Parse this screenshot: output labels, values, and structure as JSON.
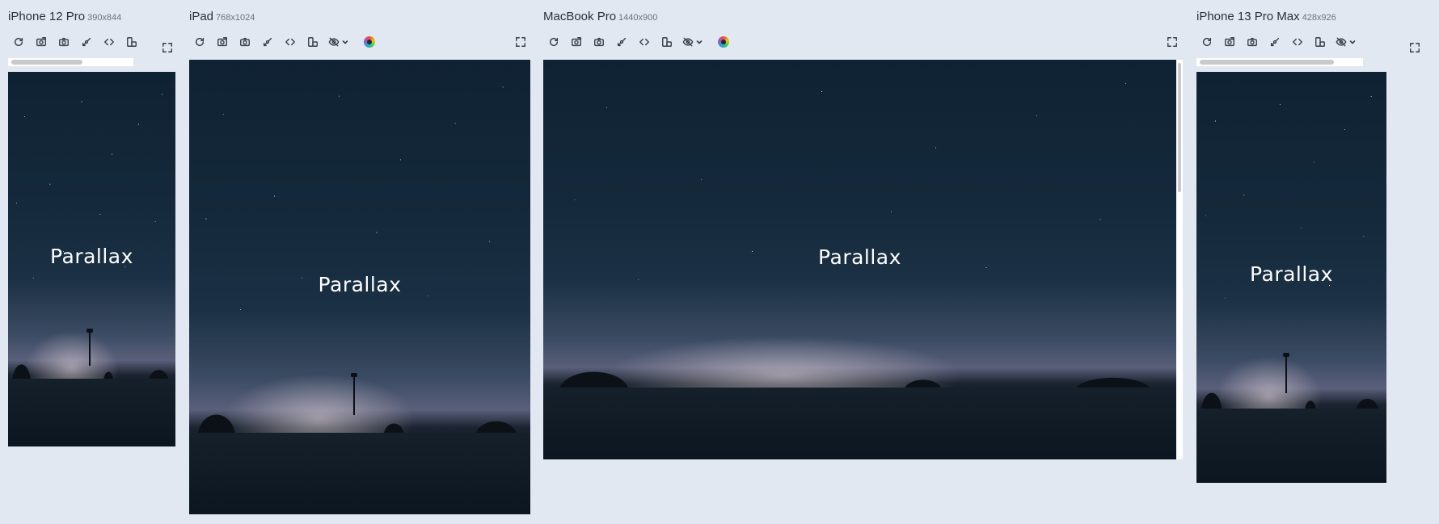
{
  "devices": [
    {
      "name": "iPhone 12 Pro",
      "size": "390x844",
      "heading": "Parallax"
    },
    {
      "name": "iPad",
      "size": "768x1024",
      "heading": "Parallax"
    },
    {
      "name": "MacBook Pro",
      "size": "1440x900",
      "heading": "Parallax"
    },
    {
      "name": "iPhone 13 Pro Max",
      "size": "428x926",
      "heading": "Parallax"
    }
  ],
  "toolbar_icons": [
    "refresh-icon",
    "screenshot-viewport-icon",
    "camera-icon",
    "sync-scroll-icon",
    "code-icon",
    "rotate-icon",
    "hide-eye-icon",
    "color-blind-icon",
    "fullscreen-icon"
  ],
  "colors": {
    "background": "#e2e8f1",
    "text": "#2b2f36",
    "sky": "#14293b"
  }
}
